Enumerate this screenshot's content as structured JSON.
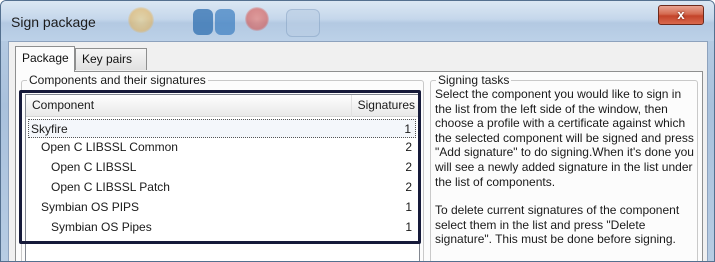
{
  "window": {
    "title": "Sign package",
    "close_label": "x"
  },
  "tabs": [
    {
      "label": "Package",
      "active": true
    },
    {
      "label": "Key pairs",
      "active": false
    }
  ],
  "components_group": {
    "legend": "Components and their signatures",
    "columns": {
      "component": "Component",
      "signatures": "Signatures"
    },
    "rows": [
      {
        "name": "Skyfire",
        "signatures": "1",
        "level": 0,
        "selected": true
      },
      {
        "name": "Open C LIBSSL Common",
        "signatures": "2",
        "level": 1,
        "selected": false
      },
      {
        "name": "Open C LIBSSL",
        "signatures": "2",
        "level": 2,
        "selected": false
      },
      {
        "name": "Open C LIBSSL Patch",
        "signatures": "2",
        "level": 2,
        "selected": false
      },
      {
        "name": "Symbian OS PIPS",
        "signatures": "1",
        "level": 1,
        "selected": false
      },
      {
        "name": "Symbian OS Pipes",
        "signatures": "1",
        "level": 2,
        "selected": false
      }
    ]
  },
  "tasks_group": {
    "legend": "Signing tasks",
    "paragraph1": "Select the component you would like to sign in the list from the left side of the window, then choose a profile with a certificate against which the selected component will be signed and press \"Add signature\" to do signing.When it's done you will see a newly added signature in the list under the list of components.",
    "paragraph2": "To delete current signatures of the component select them in the list and press \"Delete signature\". This must be done before signing."
  },
  "colors": {
    "highlight_border": "#161a3a",
    "close_button": "#c3432a"
  }
}
